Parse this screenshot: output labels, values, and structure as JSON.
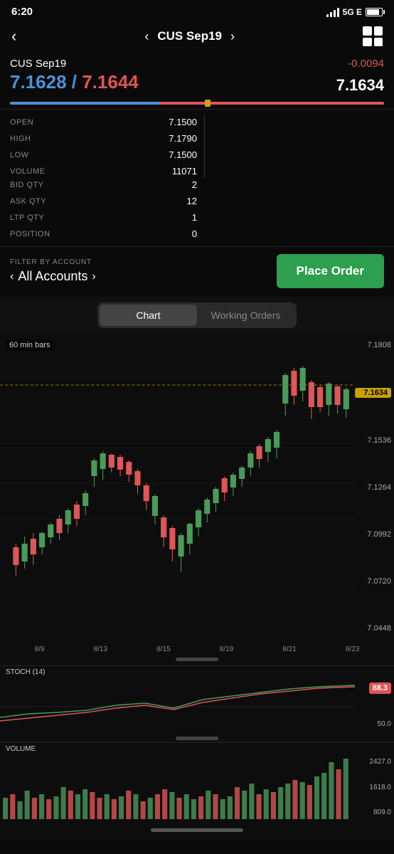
{
  "statusBar": {
    "time": "6:20",
    "networkType": "5G E",
    "batteryLevel": "85"
  },
  "navHeader": {
    "backLabel": "‹",
    "prevLabel": "‹",
    "nextLabel": "›",
    "title": "CUS Sep19",
    "gridLabel": "grid"
  },
  "priceHeader": {
    "symbol": "CUS Sep19",
    "change": "-0.0094",
    "bid": "7.1628",
    "ask": "7.1644",
    "ltp": "7.1634"
  },
  "stats": {
    "left": [
      {
        "label": "OPEN",
        "value": "7.1500"
      },
      {
        "label": "HIGH",
        "value": "7.1790"
      },
      {
        "label": "LOW",
        "value": "7.1500"
      },
      {
        "label": "VOLUME",
        "value": "11071"
      }
    ],
    "right": [
      {
        "label": "BID QTY",
        "value": "2"
      },
      {
        "label": "ASK QTY",
        "value": "12"
      },
      {
        "label": "LTP QTY",
        "value": "1"
      },
      {
        "label": "POSITION",
        "value": "0"
      }
    ]
  },
  "filter": {
    "label": "FILTER BY ACCOUNT",
    "accountName": "All Accounts"
  },
  "placeOrderButton": "Place Order",
  "tabs": {
    "items": [
      "Chart",
      "Working Orders"
    ],
    "activeIndex": 0
  },
  "chart": {
    "timeframeLabel": "60 min bars",
    "yLabels": [
      "7.1808",
      "7.1634",
      "7.1536",
      "7.1264",
      "7.0992",
      "7.0720",
      "7.0448"
    ],
    "highlightPrice": "7.1634",
    "xLabels": [
      "8/9",
      "8/13",
      "8/15",
      "8/19",
      "8/21",
      "8/23"
    ]
  },
  "stoch": {
    "label": "STOCH (14)",
    "value": "88.3",
    "midLabel": "50.0"
  },
  "volume": {
    "label": "VOLUME",
    "yLabels": [
      "2427.0",
      "1618.0",
      "809.0"
    ]
  }
}
